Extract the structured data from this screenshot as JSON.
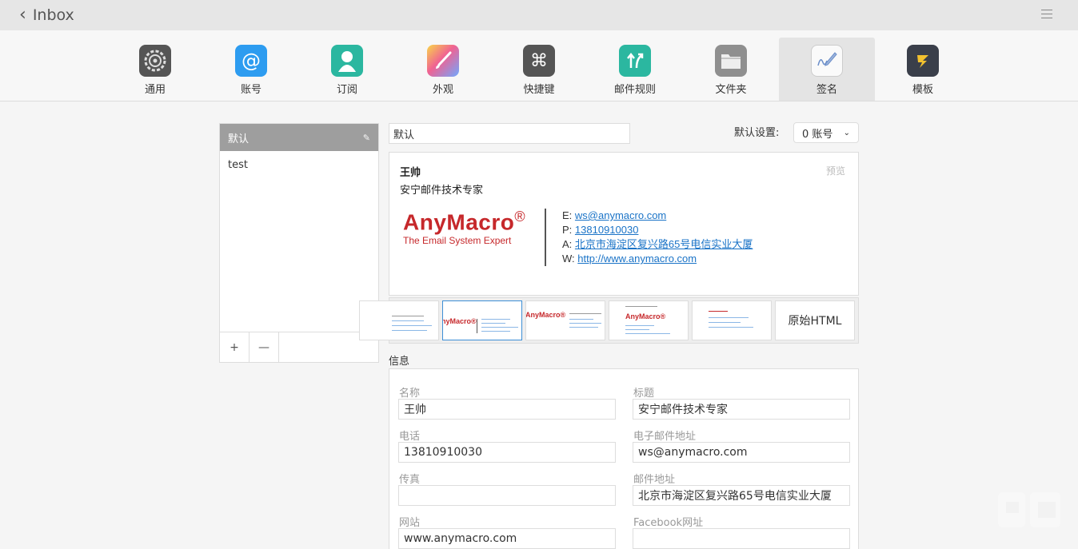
{
  "titlebar": {
    "back_label": "Inbox",
    "menu_icon": "hamburger-icon"
  },
  "toolbar": {
    "items": [
      {
        "label": "通用",
        "icon": "gear-icon",
        "color": "#5a5a5a"
      },
      {
        "label": "账号",
        "icon": "at-icon",
        "color": "#2d9cf0"
      },
      {
        "label": "订阅",
        "icon": "person-icon",
        "color": "#2bb7a0"
      },
      {
        "label": "外观",
        "icon": "brush-icon",
        "color": "#f06292"
      },
      {
        "label": "快捷键",
        "icon": "command-icon",
        "color": "#555555"
      },
      {
        "label": "邮件规则",
        "icon": "arrows-icon",
        "color": "#2bb7a0"
      },
      {
        "label": "文件夹",
        "icon": "folder-icon",
        "color": "#8f8f8f"
      },
      {
        "label": "签名",
        "icon": "signature-icon",
        "color": "#f2f2f2"
      },
      {
        "label": "模板",
        "icon": "template-icon",
        "color": "#3a3f4a"
      }
    ],
    "active_index": 7
  },
  "signatures": {
    "header_label": "默认",
    "items": [
      "test"
    ],
    "add_label": "+",
    "remove_label": "—"
  },
  "editor": {
    "name_value": "默认",
    "default_setting_label": "默认设置:",
    "account_value": "0 账号"
  },
  "preview": {
    "name": "王帅",
    "title": "安宁邮件技术专家",
    "tag": "预览",
    "logo_text": "AnyMacro",
    "logo_mark": "®",
    "logo_tagline": "The Email System Expert",
    "email_prefix": "E:",
    "email": "ws@anymacro.com",
    "phone_prefix": "P:",
    "phone": "13810910030",
    "address_prefix": "A:",
    "address": "北京市海淀区复兴路65号电信实业大厦",
    "web_prefix": "W:",
    "web": "http://www.anymacro.com"
  },
  "templates": {
    "raw_html_label": "原始HTML",
    "selected_index": 1
  },
  "info": {
    "section_label": "信息",
    "fields": {
      "name": {
        "label": "名称",
        "value": "王帅"
      },
      "title": {
        "label": "标题",
        "value": "安宁邮件技术专家"
      },
      "phone": {
        "label": "电话",
        "value": "13810910030"
      },
      "email": {
        "label": "电子邮件地址",
        "value": "ws@anymacro.com"
      },
      "fax": {
        "label": "传真",
        "value": ""
      },
      "mail_address": {
        "label": "邮件地址",
        "value": "北京市海淀区复兴路65号电信实业大厦"
      },
      "website": {
        "label": "网站",
        "value": "www.anymacro.com"
      },
      "facebook": {
        "label": "Facebook网址",
        "value": ""
      }
    }
  }
}
